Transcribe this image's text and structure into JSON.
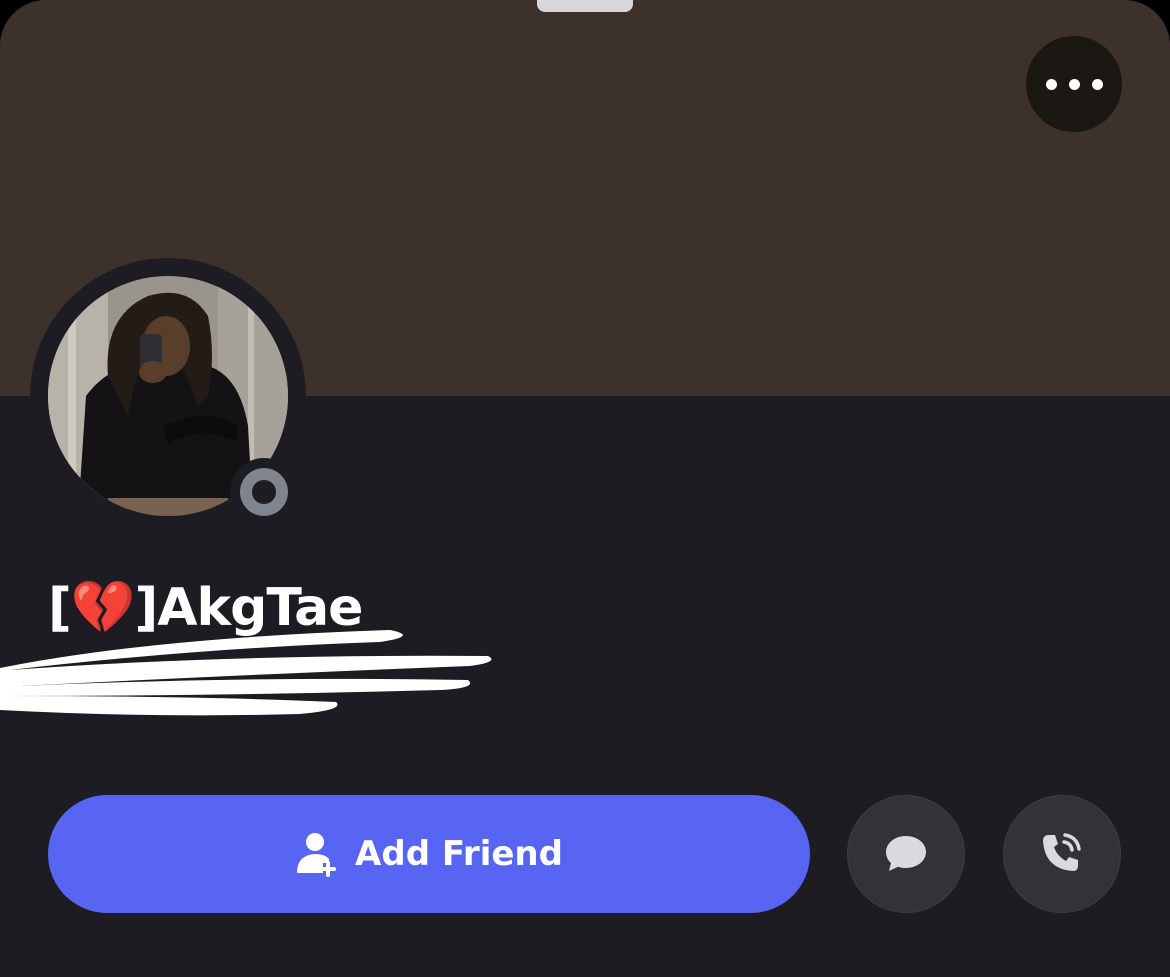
{
  "profile": {
    "display_name": "[💔]AkgTae",
    "status": "offline"
  },
  "actions": {
    "add_friend_label": "Add Friend",
    "more_icon": "more-horizontal-icon",
    "message_icon": "chat-bubble-icon",
    "call_icon": "phone-call-icon"
  },
  "colors": {
    "banner": "#3d322b",
    "background": "#1c1c22",
    "accent": "#5865f2",
    "status_offline": "#80848e"
  }
}
